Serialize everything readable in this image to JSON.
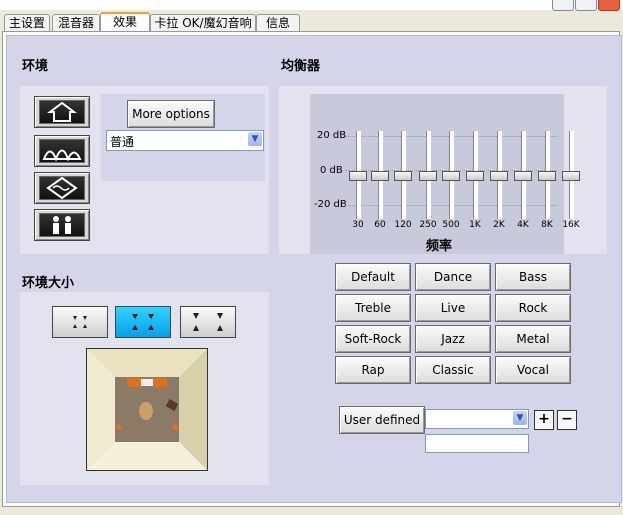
{
  "tabs": [
    {
      "label": "主设置"
    },
    {
      "label": "混音器"
    },
    {
      "label": "效果"
    },
    {
      "label": "卡拉 OK/魔幻音响"
    },
    {
      "label": "信息"
    }
  ],
  "environment": {
    "title": "环境",
    "more_options_label": "More options",
    "preset_value": "普通"
  },
  "room_size": {
    "title": "环境大小"
  },
  "equalizer": {
    "title": "均衡器",
    "db_labels": [
      "20 dB",
      "0 dB",
      "-20 dB"
    ],
    "freq_title": "频率",
    "bands": [
      "30",
      "60",
      "120",
      "250",
      "500",
      "1K",
      "2K",
      "4K",
      "8K",
      "16K"
    ],
    "band_levels_db": [
      0,
      0,
      0,
      0,
      0,
      0,
      0,
      0,
      0,
      0
    ],
    "presets": [
      "Default",
      "Dance",
      "Bass",
      "Treble",
      "Live",
      "Rock",
      "Soft-Rock",
      "Jazz",
      "Metal",
      "Rap",
      "Classic",
      "Vocal"
    ],
    "user_defined_label": "User defined",
    "user_select_value": "",
    "user_name_value": "",
    "add_label": "+",
    "remove_label": "−"
  }
}
